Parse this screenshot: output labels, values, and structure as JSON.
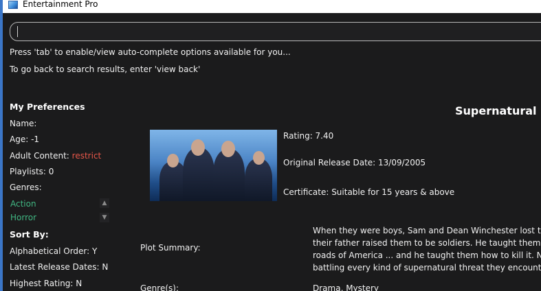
{
  "window": {
    "title": "Entertainment Pro"
  },
  "search": {
    "value": ""
  },
  "hints": [
    "Press 'tab' to enable/view auto-complete options available for you...",
    "To go back to search results, enter 'view back'"
  ],
  "preferences": {
    "title": "My Preferences",
    "name_label": "Name:",
    "age_label": "Age: -1",
    "adult_label": "Adult Content:",
    "adult_value": "restrict",
    "playlists_label": "Playlists: 0",
    "genres_label": "Genres:",
    "genres": [
      "Action",
      "Horror"
    ]
  },
  "sort": {
    "title": "Sort By:",
    "alphabetical": "Alphabetical Order: Y",
    "latest": "Latest Release Dates: N",
    "highest": "Highest Rating: N"
  },
  "show": {
    "title": "Supernatural",
    "rating": "Rating:  7.40",
    "release": "Original Release Date:  13/09/2005",
    "certificate": "Certificate:  Suitable for 15 years & above",
    "plot_label": "Plot Summary:",
    "plot_lines": [
      "When they were boys, Sam and Dean Winchester lost their m",
      "their father raised them to be soldiers. He taught them abo",
      "roads of America ... and he taught them how to kill it. Now, th",
      "battling every kind of supernatural threat they encounter alon"
    ],
    "genres_label": "Genre(s):",
    "genres_value": "Drama, Mystery"
  },
  "colors": {
    "accent_green": "#41b883",
    "restrict_red": "#e8574a",
    "background": "#1b1b1c"
  }
}
